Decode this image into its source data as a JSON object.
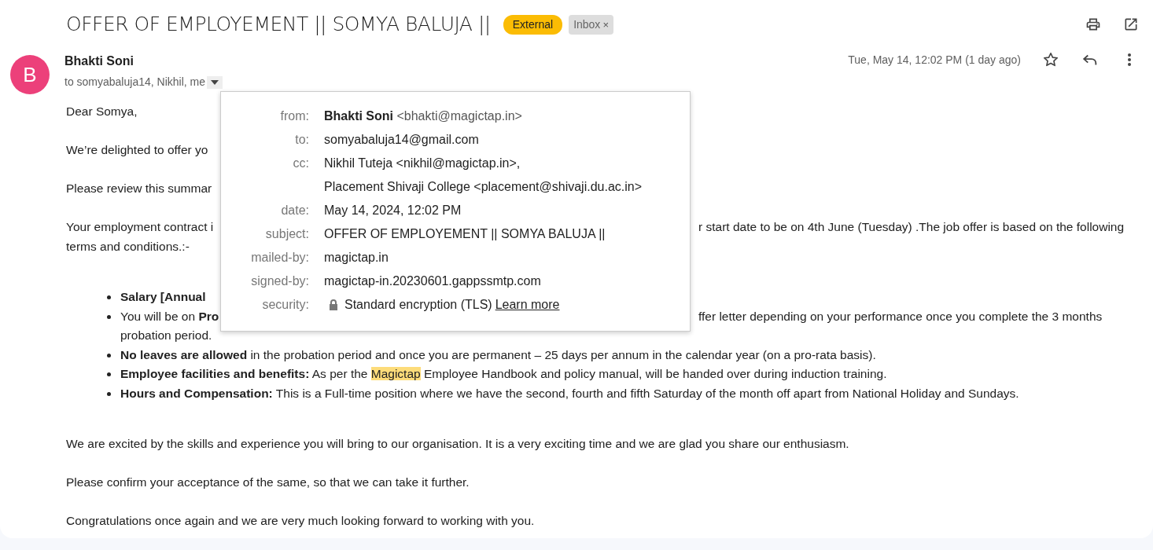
{
  "subject": "OFFER OF EMPLOYEMENT || SOMYA BALUJA ||",
  "labels": [
    {
      "text": "External",
      "kind": "external"
    },
    {
      "text": "Inbox",
      "kind": "inbox",
      "remove": "×"
    }
  ],
  "sender": {
    "initial": "B",
    "name": "Bhakti Soni",
    "recipients": "to somyabaluja14, Nikhil, me",
    "date": "Tue, May 14, 12:02 PM (1 day ago)",
    "starred": false
  },
  "details": [
    {
      "kind": "sender",
      "label": "from:",
      "name": "Bhakti Soni",
      "address": "<bhakti@magictap.in>"
    },
    {
      "kind": "text",
      "label": "to:",
      "lines": [
        "somyabaluja14@gmail.com"
      ]
    },
    {
      "kind": "text",
      "label": "cc:",
      "lines": [
        "Nikhil Tuteja <nikhil@magictap.in>,",
        "Placement Shivaji College <placement@shivaji.du.ac.in>"
      ]
    },
    {
      "kind": "text",
      "label": "date:",
      "lines": [
        "May 14, 2024, 12:02 PM"
      ]
    },
    {
      "kind": "text",
      "label": "subject:",
      "lines": [
        "OFFER OF EMPLOYEMENT || SOMYA BALUJA ||"
      ]
    },
    {
      "kind": "text",
      "label": "mailed-by:",
      "lines": [
        "magictap.in"
      ]
    },
    {
      "kind": "text",
      "label": "signed-by:",
      "lines": [
        "magictap-in.20230601.gappssmtp.com"
      ]
    },
    {
      "kind": "security",
      "label": "security:",
      "text": "Standard encryption (TLS)",
      "link": "Learn more"
    }
  ],
  "body": [
    {
      "kind": "paragraph",
      "segments": [
        {
          "text": "Dear Somya,"
        }
      ]
    },
    {
      "kind": "paragraph",
      "segments": [
        {
          "text": "We’re delighted to offer yo"
        }
      ]
    },
    {
      "kind": "paragraph",
      "segments": [
        {
          "text": "Please review this summar"
        }
      ]
    },
    {
      "kind": "line",
      "segments": [
        {
          "text": "Your employment contract i"
        }
      ],
      "right": "r start date to be on 4th June (Tuesday) .The job offer is based on the following"
    },
    {
      "kind": "line",
      "segments": [
        {
          "text": "terms and conditions.:-"
        }
      ]
    },
    {
      "kind": "gap"
    },
    {
      "kind": "bullet",
      "segments": [
        {
          "text": "Salary [Annual",
          "bold": true
        }
      ]
    },
    {
      "kind": "bullet",
      "segments": [
        {
          "text": "You will be on "
        },
        {
          "text": "Pro",
          "bold": true
        }
      ],
      "right": "ffer letter depending on your performance once you complete the 3 months"
    },
    {
      "kind": "continuation",
      "segments": [
        {
          "text": "probation period."
        }
      ]
    },
    {
      "kind": "bullet",
      "segments": [
        {
          "text": "No leaves are allowed",
          "bold": true
        },
        {
          "text": " in the probation period and once you are permanent – 25 days per annum in the calendar year (on a pro-rata basis)."
        }
      ]
    },
    {
      "kind": "bullet",
      "segments": [
        {
          "text": "Employee facilities and benefits:",
          "bold": true
        },
        {
          "text": " As per the "
        },
        {
          "text": "Magictap",
          "highlight": true
        },
        {
          "text": " Employee Handbook and policy manual, will be handed over during induction training."
        }
      ]
    },
    {
      "kind": "bullet",
      "segments": [
        {
          "text": "Hours and Compensation:",
          "bold": true
        },
        {
          "text": " This is a Full-time position where we have the second, fourth and fifth Saturday of the month off apart from National Holiday and Sundays."
        }
      ]
    },
    {
      "kind": "gap"
    },
    {
      "kind": "paragraph",
      "segments": [
        {
          "text": "We are excited by the skills and experience you will bring to our organisation. It is a very exciting time and we are glad you share our enthusiasm."
        }
      ]
    },
    {
      "kind": "paragraph",
      "segments": [
        {
          "text": "Please confirm your acceptance of the same, so that we can take it further."
        }
      ]
    },
    {
      "kind": "paragraph",
      "segments": [
        {
          "text": "Congratulations once again and we are very much looking forward to working with you."
        }
      ]
    }
  ]
}
